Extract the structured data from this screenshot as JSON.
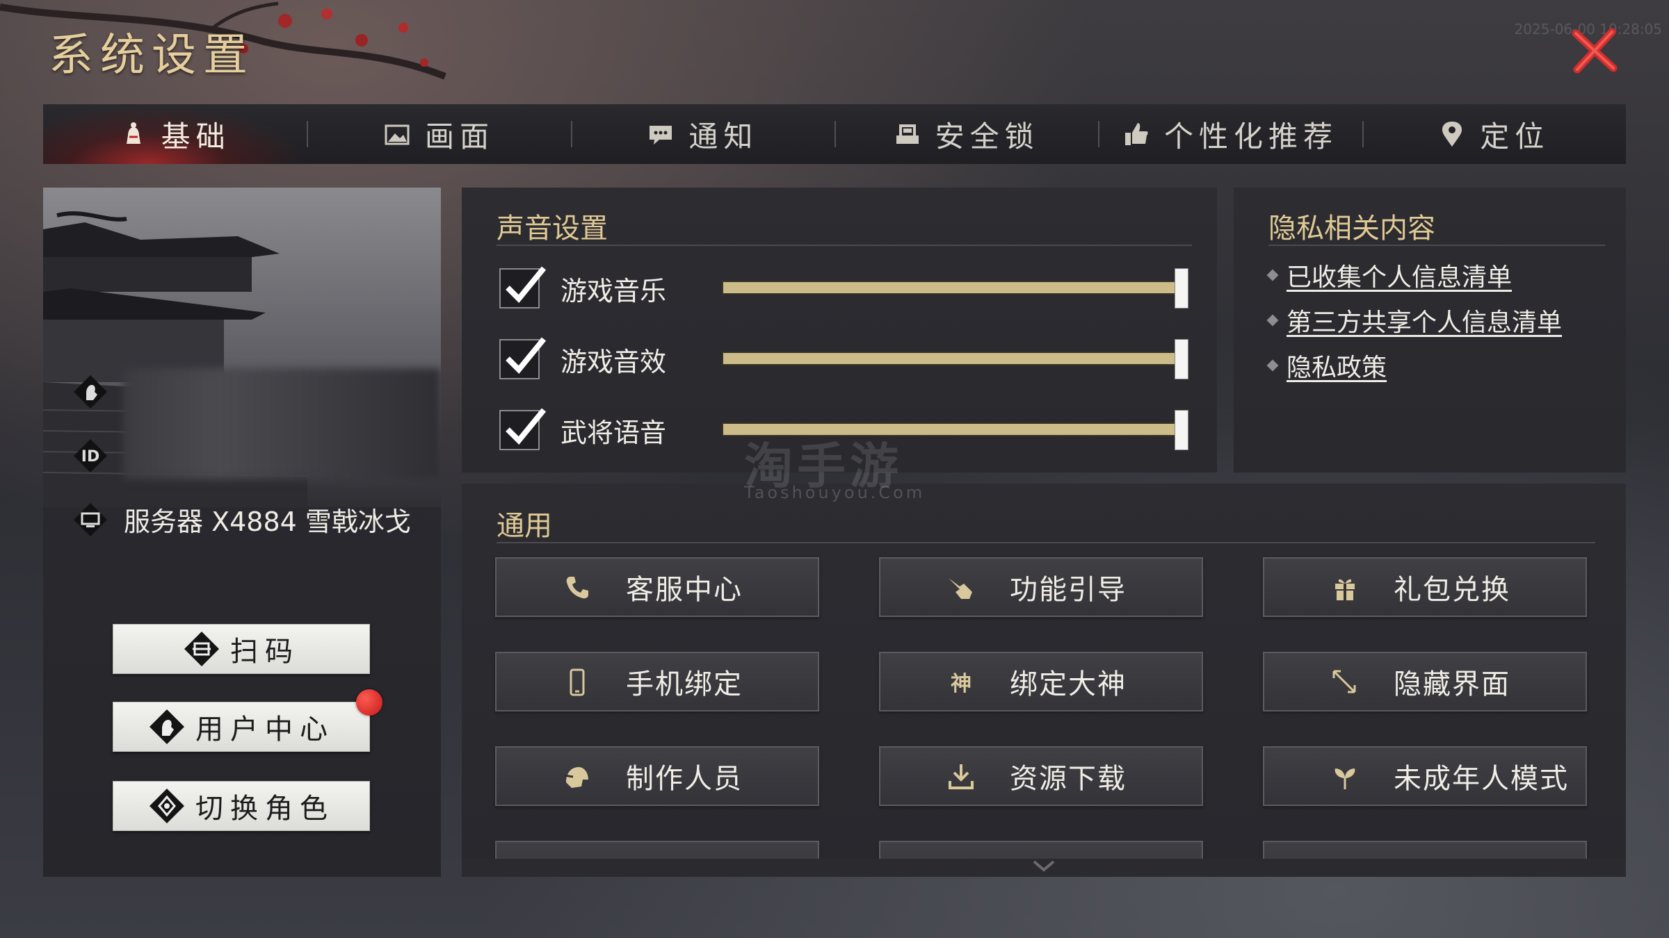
{
  "window": {
    "title": "系统设置",
    "timestamp": "2025-06-00 10:28:05"
  },
  "tabs": [
    {
      "label": "基础",
      "icon": "hand-bell-icon",
      "active": true
    },
    {
      "label": "画面",
      "icon": "picture-icon",
      "active": false
    },
    {
      "label": "通知",
      "icon": "chat-bubble-icon",
      "active": false
    },
    {
      "label": "安全锁",
      "icon": "lock-icon",
      "active": false
    },
    {
      "label": "个性化推荐",
      "icon": "thumbs-up-icon",
      "active": false
    },
    {
      "label": "定位",
      "icon": "location-pin-icon",
      "active": false
    }
  ],
  "profile": {
    "server": "服务器 X4884 雪戟冰戈",
    "buttons": {
      "scan": "扫码",
      "user_center": "用户中心",
      "switch_role": "切换角色"
    },
    "user_center_has_notification": true
  },
  "sound": {
    "title": "声音设置",
    "rows": [
      {
        "label": "游戏音乐",
        "checked": true,
        "level": 1.0
      },
      {
        "label": "游戏音效",
        "checked": true,
        "level": 1.0
      },
      {
        "label": "武将语音",
        "checked": true,
        "level": 1.0
      }
    ]
  },
  "privacy": {
    "title": "隐私相关内容",
    "links": [
      "已收集个人信息清单",
      "第三方共享个人信息清单",
      "隐私政策"
    ]
  },
  "general": {
    "title": "通用",
    "buttons": [
      {
        "label": "客服中心",
        "icon": "phone-icon"
      },
      {
        "label": "功能引导",
        "icon": "pointing-hand-icon"
      },
      {
        "label": "礼包兑换",
        "icon": "gift-icon"
      },
      {
        "label": "手机绑定",
        "icon": "mobile-phone-icon"
      },
      {
        "label": "绑定大神",
        "icon": "shen-glyph-icon"
      },
      {
        "label": "隐藏界面",
        "icon": "resize-arrows-icon"
      },
      {
        "label": "制作人员",
        "icon": "helmet-icon"
      },
      {
        "label": "资源下载",
        "icon": "download-icon"
      },
      {
        "label": "未成年人模式",
        "icon": "sprout-icon"
      }
    ]
  },
  "watermark": {
    "main": "淘手游",
    "sub": "Taoshouyou.Com"
  },
  "colors": {
    "accent_gold": "#e0c995",
    "slider_fill": "#ccbc8a",
    "active_tab_red": "#c42a2a",
    "close_red": "#d42d2d",
    "notification_red": "#c21919"
  }
}
